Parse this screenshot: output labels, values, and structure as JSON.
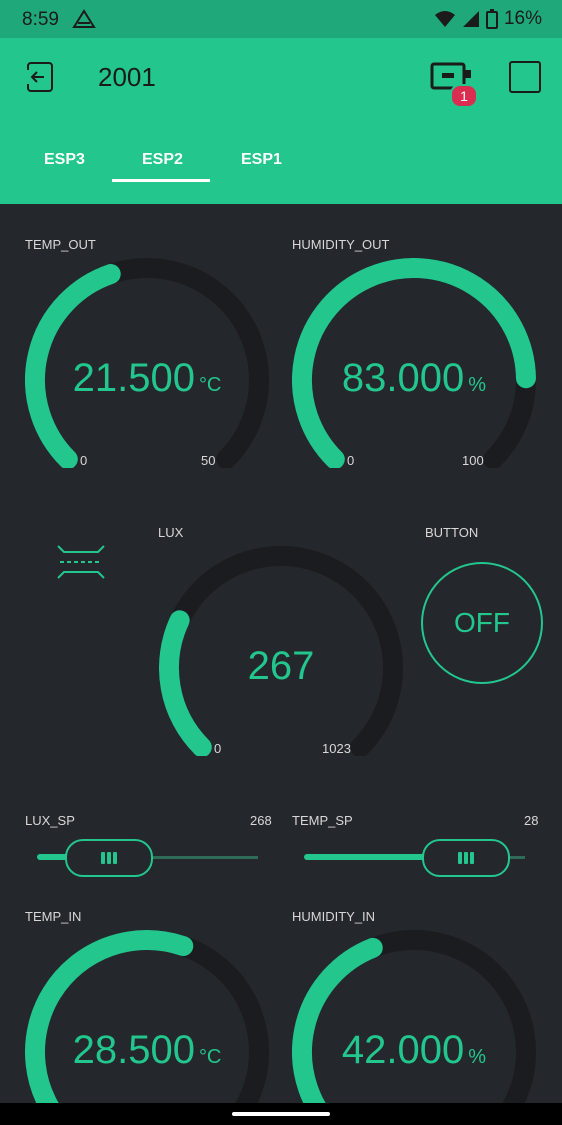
{
  "status": {
    "time": "8:59",
    "battery": "16%"
  },
  "header": {
    "title": "2001",
    "badge": "1"
  },
  "tabs": [
    {
      "label": "ESP3"
    },
    {
      "label": "ESP2"
    },
    {
      "label": "ESP1"
    }
  ],
  "widgets": {
    "temp_out": {
      "label": "TEMP_OUT",
      "value": "21.500",
      "unit": "°C",
      "min": "0",
      "max": "50",
      "fraction": 0.43
    },
    "humidity_out": {
      "label": "HUMIDITY_OUT",
      "value": "83.000",
      "unit": "%",
      "min": "0",
      "max": "100",
      "fraction": 0.83
    },
    "lux": {
      "label": "LUX",
      "value": "267",
      "min": "0",
      "max": "1023",
      "fraction": 0.26
    },
    "button": {
      "label": "BUTTON",
      "state": "OFF"
    },
    "lux_sp": {
      "label": "LUX_SP",
      "value": "268",
      "fraction": 0.26
    },
    "temp_sp": {
      "label": "TEMP_SP",
      "value": "28",
      "fraction": 0.74
    },
    "temp_in": {
      "label": "TEMP_IN",
      "value": "28.500",
      "unit": "°C",
      "fraction": 0.57
    },
    "humidity_in": {
      "label": "HUMIDITY_IN",
      "value": "42.000",
      "unit": "%",
      "fraction": 0.42
    }
  },
  "colors": {
    "accent": "#23c68d",
    "background": "#24272c",
    "track": "#1a1c20"
  }
}
